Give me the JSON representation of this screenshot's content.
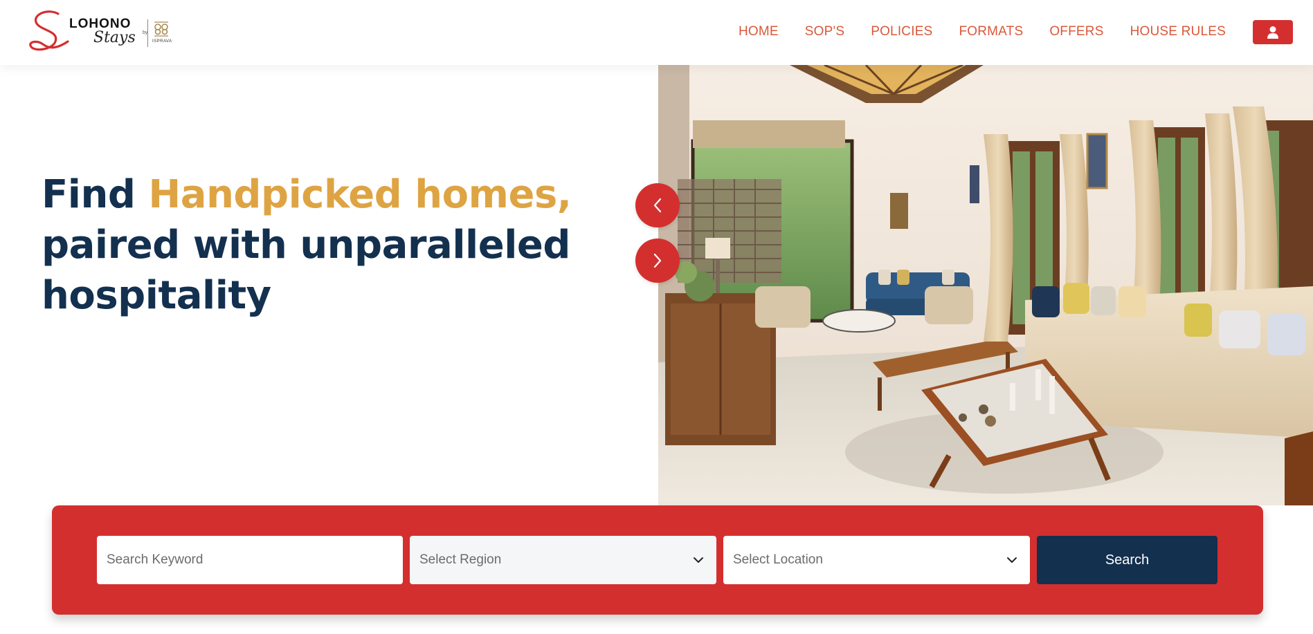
{
  "brand": {
    "name": "LOHONO",
    "script": "Stays",
    "by": "by",
    "partner": "ISPRAVA"
  },
  "nav": {
    "items": [
      {
        "label": "HOME"
      },
      {
        "label": "SOP'S"
      },
      {
        "label": "POLICIES"
      },
      {
        "label": "FORMATS"
      },
      {
        "label": "OFFERS"
      },
      {
        "label": "HOUSE RULES"
      }
    ],
    "profile_icon": "user-icon"
  },
  "hero": {
    "title_lead": "Find ",
    "title_accent": "Handpicked homes,",
    "title_rest": "paired with unparalleled hospitality",
    "image_icon": "living-room-photo",
    "prev_icon": "chevron-left-icon",
    "next_icon": "chevron-right-icon"
  },
  "search": {
    "keyword_placeholder": "Search Keyword",
    "region_label": "Select Region",
    "location_label": "Select Location",
    "button_label": "Search",
    "dropdown_icon": "chevron-down-icon"
  },
  "colors": {
    "brand_red": "#d42f2f",
    "navy": "#13304f",
    "accent_gold": "#dea443",
    "nav_orange": "#d9583a"
  }
}
